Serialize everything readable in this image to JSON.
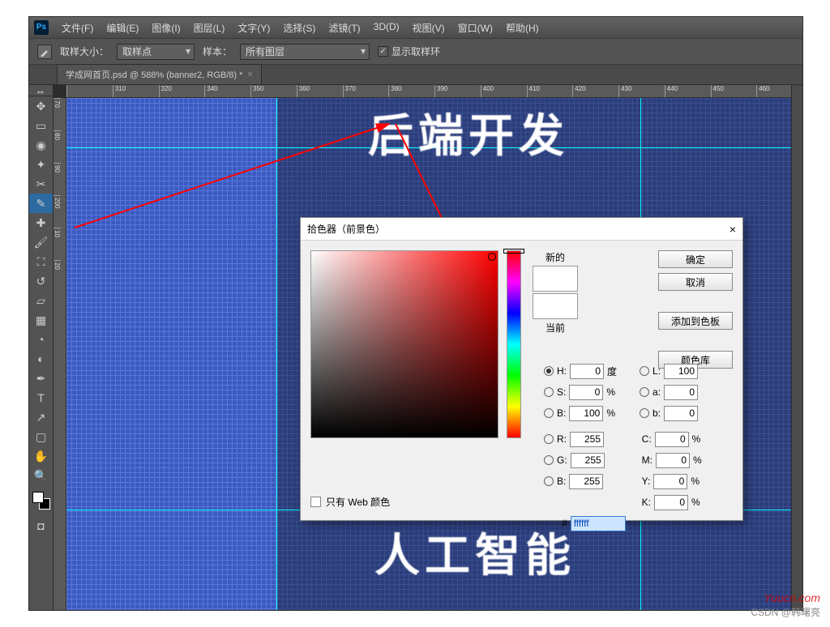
{
  "app": {
    "logo": "Ps"
  },
  "menu": [
    "文件(F)",
    "编辑(E)",
    "图像(I)",
    "图层(L)",
    "文字(Y)",
    "选择(S)",
    "滤镜(T)",
    "3D(D)",
    "视图(V)",
    "窗口(W)",
    "帮助(H)"
  ],
  "options": {
    "sample_size_label": "取样大小：",
    "sample_size_value": "取样点",
    "sample_from_label": "样本：",
    "sample_from_value": "所有图层",
    "show_ring_label": "显示取样环",
    "show_ring_checked": "✓"
  },
  "document": {
    "tab_title": "学成网首页.psd @ 588% (banner2, RGB/8) *"
  },
  "ruler_h": [
    "",
    "310",
    "320",
    "340",
    "350",
    "360",
    "370",
    "380",
    "390",
    "400",
    "410",
    "420",
    "430",
    "440",
    "450",
    "460"
  ],
  "ruler_v": [
    "70",
    "",
    "",
    "80",
    "",
    "",
    "90",
    "",
    "200",
    "",
    "",
    "10",
    "",
    "",
    "20"
  ],
  "canvas_text": {
    "top": "后端开发",
    "bottom": "人工智能"
  },
  "dialog": {
    "title": "拾色器（前景色）",
    "close": "×",
    "new_label": "新的",
    "current_label": "当前",
    "buttons": {
      "ok": "确定",
      "cancel": "取消",
      "add_swatch": "添加到色板",
      "libraries": "颜色库"
    },
    "hsb": {
      "h_label": "H:",
      "h_val": "0",
      "h_unit": "度",
      "s_label": "S:",
      "s_val": "0",
      "s_unit": "%",
      "b_label": "B:",
      "b_val": "100",
      "b_unit_pct": "%"
    },
    "lab": {
      "l_label": "L:",
      "l_val": "100",
      "a_label": "a:",
      "a_val": "0",
      "b_label": "b:",
      "b_val": "0"
    },
    "rgb": {
      "r_label": "R:",
      "r_val": "255",
      "g_label": "G:",
      "g_val": "255",
      "b_label": "B:",
      "b_val": "255"
    },
    "cmyk": {
      "c_label": "C:",
      "c_val": "0",
      "m_label": "M:",
      "m_val": "0",
      "y_label": "Y:",
      "y_val": "0",
      "k_label": "K:",
      "k_val": "0",
      "unit": "%"
    },
    "hex_label": "#",
    "hex_val": "ffffff",
    "web_only": "只有 Web 颜色"
  },
  "watermark": {
    "site": "Yuucn.com",
    "credit": "CSDN @韩曙亮"
  }
}
